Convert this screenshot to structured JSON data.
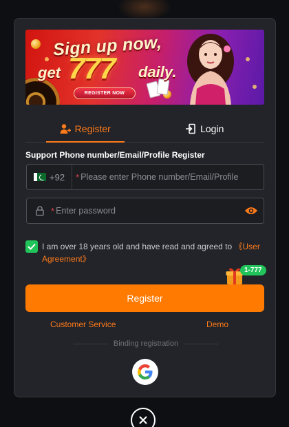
{
  "banner": {
    "line1": "Sign up now,",
    "get": "get",
    "amount": "777",
    "daily": "daily.",
    "cta": "REGISTER NOW"
  },
  "tabs": [
    {
      "label": "Register",
      "icon": "add-user-icon",
      "active": true
    },
    {
      "label": "Login",
      "icon": "login-icon",
      "active": false
    }
  ],
  "form": {
    "subtitle": "Support Phone number/Email/Profile Register",
    "country_code": "+92",
    "country_flag": "pakistan-flag-icon",
    "phone_required_mark": "*",
    "phone_placeholder": "Please enter Phone number/Email/Profile",
    "password_required_mark": "*",
    "password_placeholder": "Enter password",
    "agreement_checked": true,
    "agreement_text": "I am over 18 years old and have read and agreed to ",
    "agreement_link": "《User Agreement》",
    "bonus_badge": "1-777",
    "register_button": "Register"
  },
  "links": {
    "customer_service": "Customer Service",
    "demo": "Demo"
  },
  "binding": {
    "label": "Binding registration",
    "providers": [
      "google-icon"
    ]
  },
  "colors": {
    "accent": "#ff7a00",
    "check": "#21c45a",
    "modal_bg": "#222429",
    "page_bg": "#0e0f12"
  }
}
